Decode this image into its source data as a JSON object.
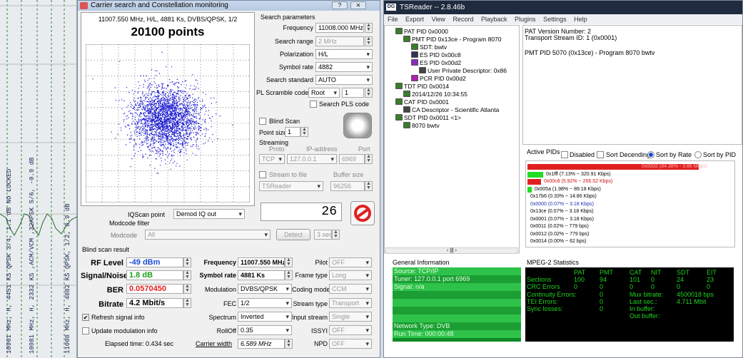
{
  "bg": {
    "strip_texts": [
      "10961 MHz, H, 4451 KS QPSK 3/4, 1.1 dB NO LOCKED",
      "10981 MHz, H, 2332 KS ,ACM/VCM ,32APSK 5/6, -0.9 dB",
      "11008 MHz, H, 4882 KS QPSK, 1/2, 8.9 dB"
    ]
  },
  "win1": {
    "title": "Carrier search and Constellation monitoring",
    "help_btn": "?",
    "close_btn": "⨯",
    "header": "11007.550 MHz, H/L, 4881 Ks, DVBS/QPSK, 1/2",
    "points": "20100 points",
    "search_params_title": "Search parameters",
    "frequency_label": "Frequency",
    "frequency_value": "11008.000 MHz",
    "search_range_label": "Search range",
    "search_range_value": "2 MHz",
    "polarization_label": "Polarization",
    "polarization_value": "H/L",
    "symbol_rate_label": "Symbol rate",
    "symbol_rate_value": "4882",
    "search_standard_label": "Search standard",
    "search_standard_value": "AUTO",
    "pl_scramble_label": "PL Scramble code",
    "pl_scramble_value": "Root",
    "pl_scramble_num": "1",
    "search_pls_label": "Search PLS code",
    "blind_scan_label": "Blind Scan",
    "point_size_label": "Point size",
    "point_size_value": "1",
    "streaming_label": "Streaming",
    "proto_hdr": "Proto",
    "ip_hdr": "IP-address",
    "port_hdr": "Port",
    "proto_value": "TCP",
    "ip_value": "127.0.0.1",
    "port_value": "6969",
    "stream_file_label": "Stream to file",
    "buffer_size_label": "Buffer size",
    "tsreader_value": "TSReader",
    "buffer_value": "96256",
    "iqscan_label": "IQScan point",
    "iqscan_value": "Demod IQ out",
    "counter_value": "26",
    "modcode_filter_label": "Modcode filter",
    "modcode_label": "Modcode",
    "modcode_value": "All",
    "detect_label": "Detect",
    "detect_sec": "3 sec",
    "blind_result_label": "Blind scan result",
    "rf_level_label": "RF Level",
    "rf_level_value": "-49 dBm",
    "snr_label": "Signal/Noise",
    "snr_value": "1.8 dB",
    "ber_label": "BER",
    "ber_value": "0.0570450",
    "bitrate_label": "Bitrate",
    "bitrate_value": "4.2 Mbit/s",
    "res_freq_label": "Frequency",
    "res_freq_value": "11007.550 MHz",
    "res_sr_label": "Symbol rate",
    "res_sr_value": "4881 Ks",
    "modulation_label": "Modulation",
    "modulation_value": "DVBS/QPSK",
    "fec_label": "FEC",
    "fec_value": "1/2",
    "spectrum_label": "Spectrum",
    "spectrum_value": "Inverted",
    "rolloff_label": "RollOff",
    "rolloff_value": "0.35",
    "carrier_width_label": "Carrier width",
    "carrier_width_value": "6.589 MHz",
    "pilot_label": "Pilot",
    "pilot_value": "OFF",
    "frame_type_label": "Frame type",
    "frame_type_value": "Long",
    "coding_mode_label": "Coding mode",
    "coding_mode_value": "CCM",
    "stream_type_label": "Stream type",
    "stream_type_value": "Transport",
    "input_stream_label": "Input stream",
    "input_stream_value": "Single",
    "issyi_label": "ISSYI",
    "issyi_value": "OFF",
    "npd_label": "NPD",
    "npd_value": "OFF",
    "refresh_label": "Refresh signal info",
    "update_mod_label": "Update modulation info",
    "elapsed_label": "Elapsed time: 0.434 sec"
  },
  "win2": {
    "title": "TSReader -- 2.8.46b",
    "menu": [
      "File",
      "Export",
      "View",
      "Record",
      "Playback",
      "Plugins",
      "Settings",
      "Help"
    ],
    "tree": [
      {
        "text": "PAT PID 0x0000",
        "lvl": 0,
        "icon": "#3a7d2c"
      },
      {
        "text": "PMT PID 0x13ce - Program 8070",
        "lvl": 1,
        "icon": "#3a7d2c"
      },
      {
        "text": "SDT: bwtv",
        "lvl": 2,
        "icon": "#3a7d2c"
      },
      {
        "text": "ES PID 0x00c8",
        "lvl": 2,
        "icon": "#335"
      },
      {
        "text": "ES PID 0x00d2",
        "lvl": 2,
        "icon": "#8a2cc0"
      },
      {
        "text": "User Private Descriptor: 0x86",
        "lvl": 3,
        "icon": "#444"
      },
      {
        "text": "PCR PID 0x00d2",
        "lvl": 2,
        "icon": "#b020b0"
      },
      {
        "text": "TDT PID 0x0014",
        "lvl": 0,
        "icon": "#3a7d2c"
      },
      {
        "text": "2014/12/26 10:34:55",
        "lvl": 1,
        "icon": "#3a7d2c"
      },
      {
        "text": "CAT PID 0x0001",
        "lvl": 0,
        "icon": "#3a7d2c"
      },
      {
        "text": "CA Descriptor - Scientific Atlanta",
        "lvl": 1,
        "icon": "#444"
      },
      {
        "text": "SDT PID 0x0011 <1>",
        "lvl": 0,
        "icon": "#3a7d2c"
      },
      {
        "text": "8070 bwtv",
        "lvl": 1,
        "icon": "#3a7d2c"
      }
    ],
    "info_lines": [
      "PAT Version Number: 2",
      "Transport Stream ID: 1 (0x0001)",
      "",
      "PMT PID 5070 (0x13ce) - Program 8070 bwtv"
    ],
    "active_pids_label": "Active PIDs",
    "disabled_label": "Disabled",
    "sort_desc_label": "Sort Decending",
    "sort_rate_label": "Sort by Rate",
    "sort_pid_label": "Sort by PID",
    "pids": [
      {
        "text": "0x00d2 (84.38% - 3.86 Mbps)",
        "pct": 100,
        "color": "#e02020",
        "tcolor": "#e02020"
      },
      {
        "text": "0x1fff (7.13% ~ 320.91 Kbps)",
        "pct": 9,
        "color": "#22dd22",
        "tcolor": "#000"
      },
      {
        "text": "0x00c8 (5.92% ~ 266.52 Kbps)",
        "pct": 8,
        "color": "#e02020",
        "tcolor": "#d01010"
      },
      {
        "text": "0x005a (1.98% ~ 89.18 Kbps)",
        "pct": 2,
        "color": "#22dd22",
        "tcolor": "#000"
      },
      {
        "text": "0x17b6 (0.33% ~ 14.86 Kbps)",
        "pct": 0,
        "color": "#22dd22",
        "tcolor": "#000"
      },
      {
        "text": "0x0000 (0.07% ~ 3.18 Kbps)",
        "pct": 0,
        "color": "#2040c0",
        "tcolor": "#1a30b0"
      },
      {
        "text": "0x13ce (0.07% ~ 3.18 Kbps)",
        "pct": 0,
        "color": "#22dd22",
        "tcolor": "#000"
      },
      {
        "text": "0x0001 (0.07% ~ 3.18 Kbps)",
        "pct": 0,
        "color": "#22dd22",
        "tcolor": "#000"
      },
      {
        "text": "0x0011 (0.02% ~ 779 bps)",
        "pct": 0,
        "color": "#22dd22",
        "tcolor": "#000"
      },
      {
        "text": "0x0012 (0.02% ~ 779 bps)",
        "pct": 0,
        "color": "#22dd22",
        "tcolor": "#000"
      },
      {
        "text": "0x0014 (0.00% ~ 62 bps)",
        "pct": 0,
        "color": "#22dd22",
        "tcolor": "#000"
      }
    ],
    "general_info_label": "General Information",
    "source": "Source: TCP/IP",
    "tuner": "Tuner: 127.0.0.1 port 6969",
    "signal": "Signal: n/a",
    "network_type": "Network Type: DVB",
    "run_time": "Run Time: 000:00:48",
    "mpeg_label": "MPEG-2 Statistics",
    "stats_hdr": [
      "PAT",
      "PMT",
      "CAT",
      "NIT",
      "SDT",
      "EIT"
    ],
    "sections_label": "Sections",
    "sections_vals": [
      "100",
      "94",
      "101",
      "0",
      "24",
      "23"
    ],
    "crc_label": "CRC Errors",
    "crc_vals": [
      "0",
      "0",
      "0",
      "0",
      "0",
      "0"
    ],
    "cont_label": "Continuity Errors:",
    "cont_val": "0",
    "tei_label": "TEI Errors:",
    "tei_val": "0",
    "sync_label": "Sync losses:",
    "sync_val": "0",
    "mux_label": "Mux bitrate:",
    "mux_val": "4500018 bps",
    "last_sec_label": "Last sec.:",
    "last_sec_val": "4.711 Mbit",
    "inbuf_label": "In buffer:",
    "outbuf_label": "Out buffer:"
  }
}
